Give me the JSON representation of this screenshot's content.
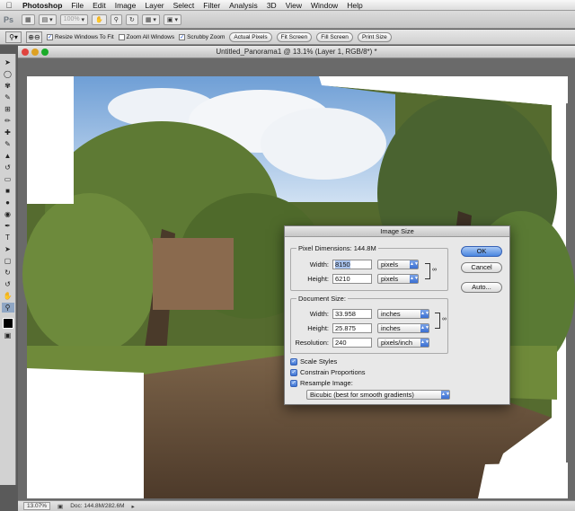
{
  "menubar": {
    "app_name": "Photoshop",
    "items": [
      "File",
      "Edit",
      "Image",
      "Layer",
      "Select",
      "Filter",
      "Analysis",
      "3D",
      "View",
      "Window",
      "Help"
    ]
  },
  "appbar": {
    "ps_label": "Ps",
    "zoom_level": "100%"
  },
  "options_bar": {
    "resize_windows": "Resize Windows To Fit",
    "zoom_all": "Zoom All Windows",
    "scrubby_zoom": "Scrubby Zoom",
    "actual_pixels": "Actual Pixels",
    "fit_screen": "Fit Screen",
    "fill_screen": "Fill Screen",
    "print_size": "Print Size"
  },
  "document": {
    "title": "Untitled_Panorama1 @ 13.1% (Layer 1, RGB/8*) *",
    "status_zoom": "13.07%",
    "status_doc": "Doc: 144.8M/282.6M"
  },
  "dialog": {
    "title": "Image Size",
    "pixel_dimensions_label": "Pixel Dimensions:",
    "pixel_dimensions_value": "144.8M",
    "width_label": "Width:",
    "height_label": "Height:",
    "px_width": "8150",
    "px_height": "6210",
    "px_width_unit": "pixels",
    "px_height_unit": "pixels",
    "document_size_label": "Document Size:",
    "doc_width": "33.958",
    "doc_height": "25.875",
    "doc_width_unit": "inches",
    "doc_height_unit": "inches",
    "resolution_label": "Resolution:",
    "resolution": "240",
    "resolution_unit": "pixels/inch",
    "scale_styles": "Scale Styles",
    "constrain_proportions": "Constrain Proportions",
    "resample_image": "Resample Image:",
    "resample_method": "Bicubic (best for smooth gradients)",
    "ok": "OK",
    "cancel": "Cancel",
    "auto": "Auto..."
  },
  "colors": {
    "accent": "#3e74d4",
    "close": "#e0443e",
    "minimize": "#dea123",
    "zoom": "#1aab29"
  }
}
